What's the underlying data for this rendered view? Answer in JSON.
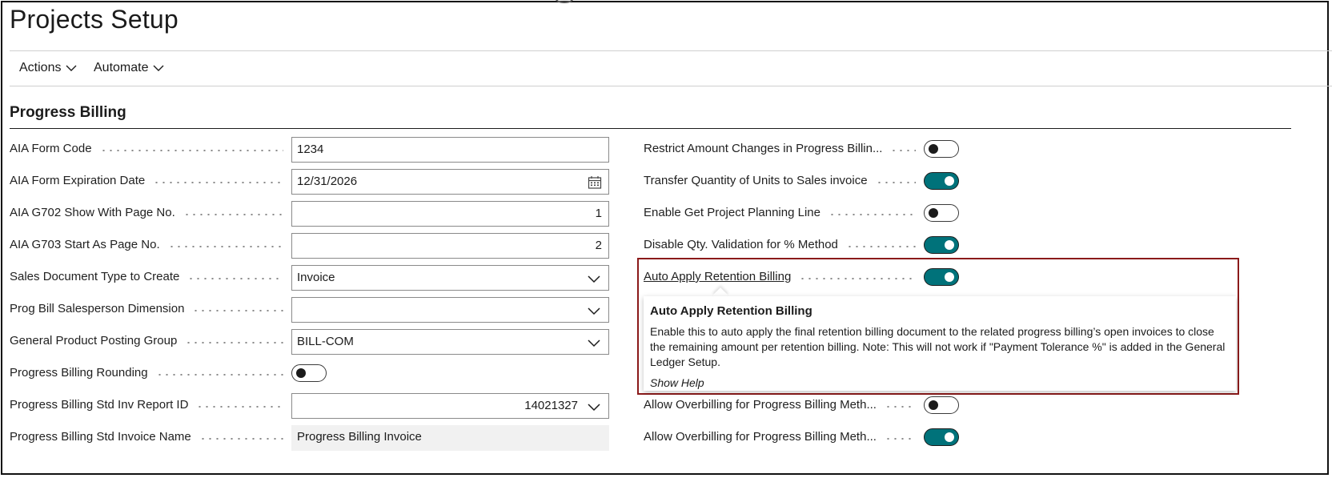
{
  "page": {
    "title": "Projects Setup"
  },
  "menu": {
    "actions_label": "Actions",
    "automate_label": "Automate"
  },
  "section": {
    "title": "Progress Billing"
  },
  "left_fields": [
    {
      "label": "AIA Form Code",
      "value": "1234"
    },
    {
      "label": "AIA Form Expiration Date",
      "value": "12/31/2026"
    },
    {
      "label": "AIA G702 Show With Page No.",
      "value": "1"
    },
    {
      "label": "AIA G703 Start As Page No.",
      "value": "2"
    },
    {
      "label": "Sales Document Type to Create",
      "value": "Invoice"
    },
    {
      "label": "Prog Bill Salesperson Dimension",
      "value": ""
    },
    {
      "label": "General Product Posting Group",
      "value": "BILL-COM"
    },
    {
      "label": "Progress Billing Rounding",
      "value": "off"
    },
    {
      "label": "Progress Billing Std Inv Report ID",
      "value": "14021327"
    },
    {
      "label": "Progress Billing Std Invoice Name",
      "value": "Progress Billing Invoice"
    }
  ],
  "right_fields": [
    {
      "label": "Restrict Amount Changes in Progress Billin...",
      "state": "off"
    },
    {
      "label": "Transfer Quantity of Units to Sales invoice",
      "state": "on"
    },
    {
      "label": "Enable Get Project Planning Line",
      "state": "off"
    },
    {
      "label": "Disable Qty. Validation for % Method",
      "state": "on"
    },
    {
      "label": "Auto Apply Retention Billing",
      "state": "on"
    },
    {
      "label": "Allow Overbilling for Progress Billing Meth...",
      "state": "off"
    },
    {
      "label": "Allow Overbilling for Progress Billing Meth...",
      "state": "on"
    }
  ],
  "tooltip": {
    "title": "Auto Apply Retention Billing",
    "body": "Enable this to auto apply the final retention billing document to the related progress billing’s open invoices to close the remaining amount per retention billing. Note: This will not work if \"Payment Tolerance %\" is added in the General Ledger Setup.",
    "help_link": "Show Help"
  },
  "colors": {
    "toggle_on": "#00727a",
    "callout_border": "#8b1a1a"
  },
  "icons": {
    "calendar": "calendar-icon",
    "dropdown": "chevron-down-icon"
  }
}
